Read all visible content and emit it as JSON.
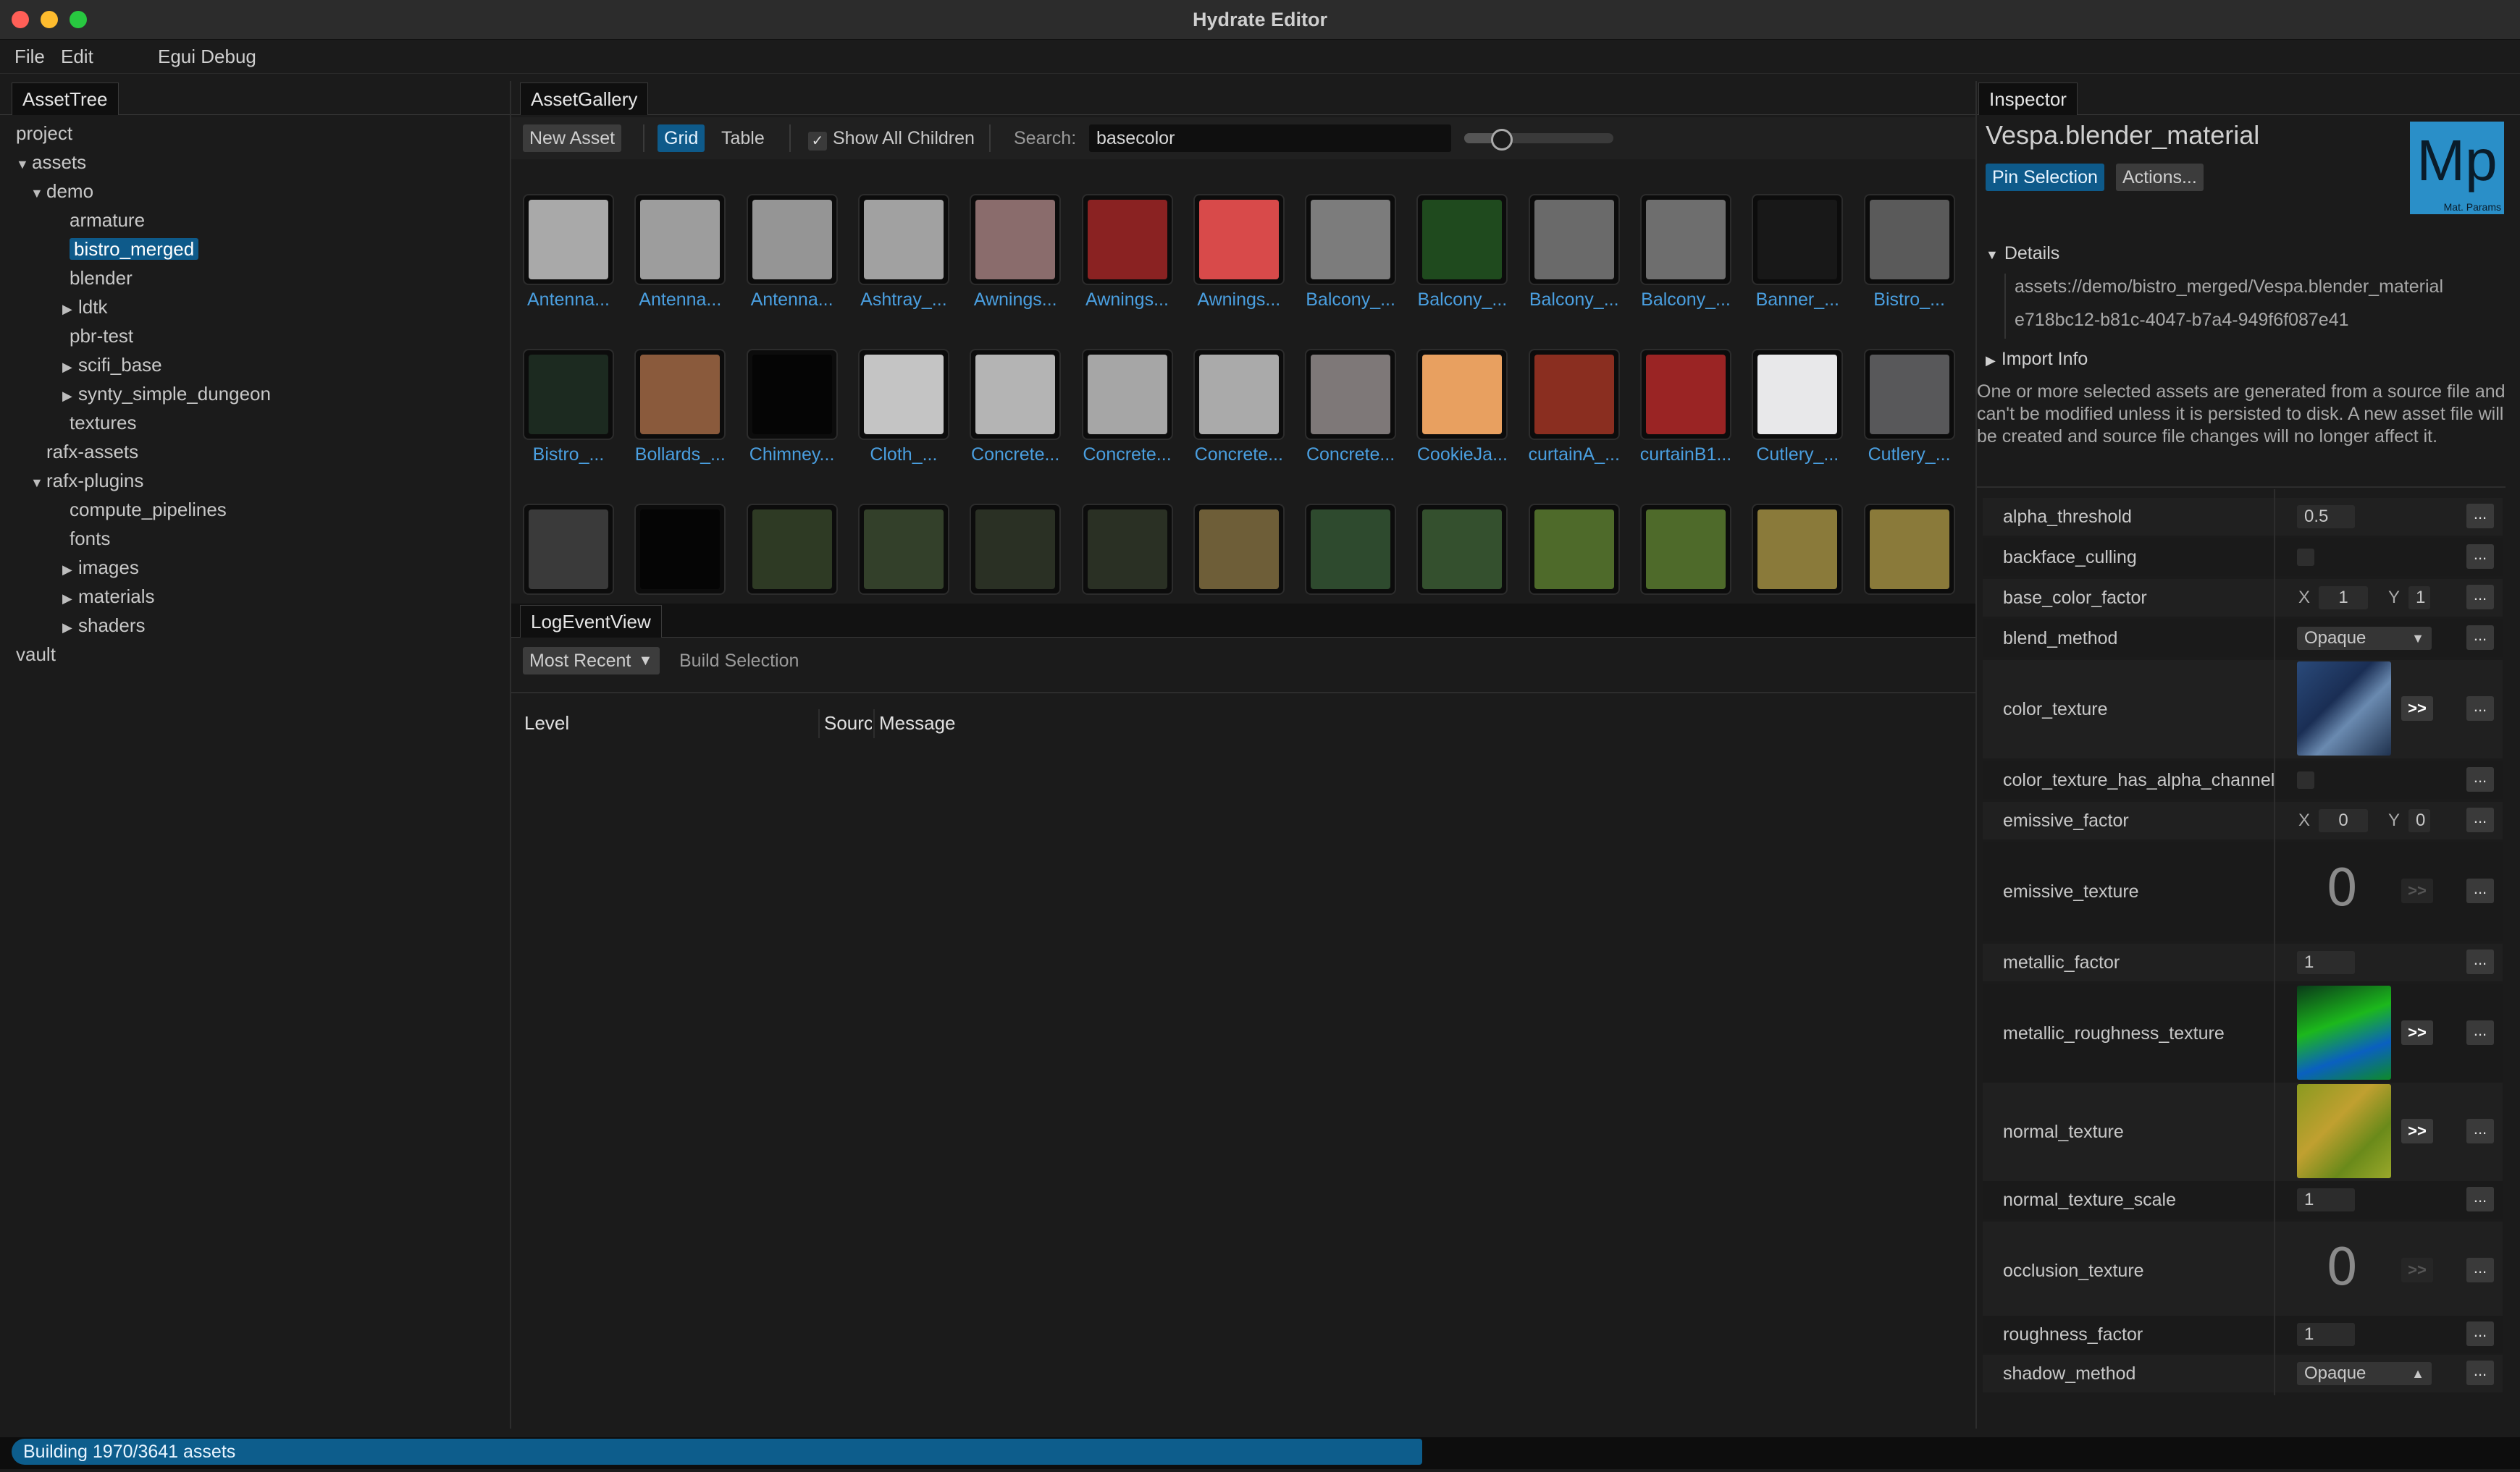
{
  "window": {
    "title": "Hydrate Editor"
  },
  "menu": [
    "File",
    "Edit",
    "Egui Debug"
  ],
  "asset_tree": {
    "tab": "AssetTree",
    "rows": [
      {
        "label": "project",
        "depth": 0,
        "arrow": ""
      },
      {
        "label": "assets",
        "depth": 0,
        "arrow": "▼"
      },
      {
        "label": "demo",
        "depth": 1,
        "arrow": "▼"
      },
      {
        "label": "armature",
        "depth": 2,
        "arrow": ""
      },
      {
        "label": "bistro_merged",
        "depth": 2,
        "arrow": "",
        "selected": true
      },
      {
        "label": "blender",
        "depth": 2,
        "arrow": ""
      },
      {
        "label": "ldtk",
        "depth": 2,
        "arrow": "▶"
      },
      {
        "label": "pbr-test",
        "depth": 2,
        "arrow": ""
      },
      {
        "label": "scifi_base",
        "depth": 2,
        "arrow": "▶"
      },
      {
        "label": "synty_simple_dungeon",
        "depth": 2,
        "arrow": "▶"
      },
      {
        "label": "textures",
        "depth": 2,
        "arrow": ""
      },
      {
        "label": "rafx-assets",
        "depth": 1,
        "arrow": ""
      },
      {
        "label": "rafx-plugins",
        "depth": 1,
        "arrow": "▼"
      },
      {
        "label": "compute_pipelines",
        "depth": 2,
        "arrow": ""
      },
      {
        "label": "fonts",
        "depth": 2,
        "arrow": ""
      },
      {
        "label": "images",
        "depth": 2,
        "arrow": "▶"
      },
      {
        "label": "materials",
        "depth": 2,
        "arrow": "▶"
      },
      {
        "label": "shaders",
        "depth": 2,
        "arrow": "▶"
      },
      {
        "label": "vault",
        "depth": 0,
        "arrow": ""
      }
    ]
  },
  "gallery": {
    "tab": "AssetGallery",
    "new_asset": "New Asset",
    "grid": "Grid",
    "table": "Table",
    "show_all_children": "Show All Children",
    "show_all_checked": true,
    "search_label": "Search:",
    "search_value": "basecolor",
    "zoom_level": 0.25,
    "row1": [
      {
        "label": "Antenna...",
        "color": "#a9a9a9"
      },
      {
        "label": "Antenna...",
        "color": "#9d9d9d"
      },
      {
        "label": "Antenna...",
        "color": "#959595"
      },
      {
        "label": "Ashtray_...",
        "color": "#a1a1a1"
      },
      {
        "label": "Awnings...",
        "color": "#8a6c6c"
      },
      {
        "label": "Awnings...",
        "color": "#8a2222"
      },
      {
        "label": "Awnings...",
        "color": "#d84a4a"
      },
      {
        "label": "Balcony_...",
        "color": "#7c7c7c"
      },
      {
        "label": "Balcony_...",
        "color": "#1f4a1e"
      },
      {
        "label": "Balcony_...",
        "color": "#6a6a6a"
      },
      {
        "label": "Balcony_...",
        "color": "#6e6e6e"
      },
      {
        "label": "Banner_...",
        "color": "#181818"
      },
      {
        "label": "Bistro_...",
        "color": "#5a5a5a"
      }
    ],
    "row2": [
      {
        "label": "Bistro_...",
        "color": "#1c2a20"
      },
      {
        "label": "Bollards_...",
        "color": "#8a5a3c"
      },
      {
        "label": "Chimney...",
        "color": "#050505"
      },
      {
        "label": "Cloth_...",
        "color": "#c4c4c4"
      },
      {
        "label": "Concrete...",
        "color": "#b4b4b4"
      },
      {
        "label": "Concrete...",
        "color": "#a6a6a6"
      },
      {
        "label": "Concrete...",
        "color": "#aaaaaa"
      },
      {
        "label": "Concrete...",
        "color": "#7e7878"
      },
      {
        "label": "CookieJa...",
        "color": "#e8a060"
      },
      {
        "label": "curtainA_...",
        "color": "#8a2e20"
      },
      {
        "label": "curtainB1...",
        "color": "#9a2424"
      },
      {
        "label": "Cutlery_...",
        "color": "#e8e8ea"
      },
      {
        "label": "Cutlery_...",
        "color": "#58585a"
      }
    ],
    "row3": [
      {
        "color": "#3a3a3a"
      },
      {
        "color": "#050505"
      },
      {
        "color": "#2e3a24"
      },
      {
        "color": "#33402a"
      },
      {
        "color": "#2a3024"
      },
      {
        "color": "#2a3024"
      },
      {
        "color": "#6e5e38"
      },
      {
        "color": "#2e4a2e"
      },
      {
        "color": "#34502e"
      },
      {
        "color": "#4e6a2a"
      },
      {
        "color": "#4e6a2a"
      },
      {
        "color": "#8a7a3a"
      },
      {
        "color": "#8a7a3a"
      }
    ]
  },
  "log": {
    "tab": "LogEventView",
    "dropdown": "Most Recent",
    "build_selection": "Build Selection",
    "columns": [
      "Level",
      "Sourc",
      "Message"
    ]
  },
  "inspector": {
    "tab": "Inspector",
    "asset_name": "Vespa.blender_material",
    "pin_selection": "Pin Selection",
    "actions": "Actions...",
    "thumb_text": "Mp",
    "thumb_sub": "Mat. Params",
    "thumb_color": "#2a8fc8",
    "details_label": "Details",
    "path": "assets://demo/bistro_merged/Vespa.blender_material",
    "uuid": "e718bc12-b81c-4047-b7a4-949f6f087e41",
    "import_info_label": "Import Info",
    "notice": "One or more selected assets are generated from a source file and can't be modified unless it is persisted to disk. A new asset file will be created and source file changes will no longer affect it.",
    "props": {
      "alpha_threshold": {
        "name": "alpha_threshold",
        "value": "0.5"
      },
      "backface_culling": {
        "name": "backface_culling"
      },
      "base_color_factor": {
        "name": "base_color_factor",
        "x_label": "X",
        "x": "1",
        "y_label": "Y",
        "y": "1"
      },
      "blend_method": {
        "name": "blend_method",
        "value": "Opaque"
      },
      "color_texture": {
        "name": "color_texture",
        "go": ">>"
      },
      "color_texture_has_alpha": {
        "name": "color_texture_has_alpha_channel"
      },
      "emissive_factor": {
        "name": "emissive_factor",
        "x_label": "X",
        "x": "0",
        "y_label": "Y",
        "y": "0"
      },
      "emissive_texture": {
        "name": "emissive_texture",
        "empty": "0",
        "go": ">>"
      },
      "metallic_factor": {
        "name": "metallic_factor",
        "value": "1"
      },
      "metallic_roughness_texture": {
        "name": "metallic_roughness_texture",
        "go": ">>"
      },
      "normal_texture": {
        "name": "normal_texture",
        "go": ">>"
      },
      "normal_texture_scale": {
        "name": "normal_texture_scale",
        "value": "1"
      },
      "occlusion_texture": {
        "name": "occlusion_texture",
        "empty": "0",
        "go": ">>"
      },
      "roughness_factor": {
        "name": "roughness_factor",
        "value": "1"
      },
      "shadow_method": {
        "name": "shadow_method",
        "value": "Opaque"
      }
    },
    "dots": "..."
  },
  "status": {
    "text": "Building 1970/3641 assets",
    "built": 1970,
    "total": 3641
  }
}
